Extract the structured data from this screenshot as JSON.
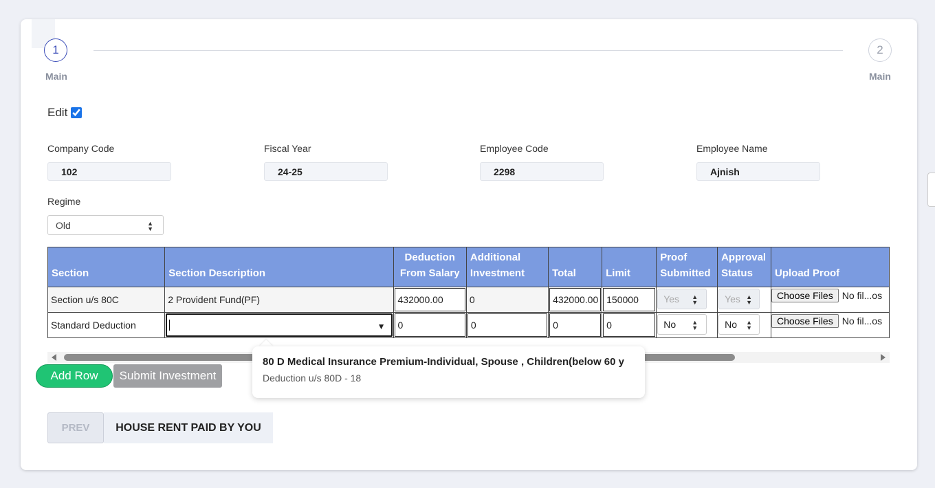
{
  "stepper": {
    "steps": [
      {
        "number": "1",
        "label": "Main"
      },
      {
        "number": "2",
        "label": "Main"
      }
    ]
  },
  "edit": {
    "label": "Edit",
    "checked": true
  },
  "fields": {
    "company_code": {
      "label": "Company Code",
      "value": "102"
    },
    "fiscal_year": {
      "label": "Fiscal Year",
      "value": "24-25"
    },
    "employee_code": {
      "label": "Employee Code",
      "value": "2298"
    },
    "employee_name": {
      "label": "Employee Name",
      "value": "Ajnish"
    }
  },
  "regime": {
    "label": "Regime",
    "value": "Old"
  },
  "table": {
    "headers": {
      "section": "Section",
      "section_description": "Section Description",
      "deduction_from_salary": "Deduction From Salary",
      "additional_investment": "Additional Investment",
      "total": "Total",
      "limit": "Limit",
      "proof_submitted": "Proof Submitted",
      "approval_status": "Approval Status",
      "upload_proof": "Upload Proof"
    },
    "rows": [
      {
        "section": "Section u/s 80C",
        "section_description": "2 Provident Fund(PF)",
        "deduction_from_salary": "432000.00",
        "additional_investment": "0",
        "total": "432000.00",
        "limit": "150000",
        "proof_submitted": "Yes",
        "approval_status": "Yes",
        "upload_button": "Choose Files",
        "upload_status": "No fil...os"
      },
      {
        "section": "Standard Deduction",
        "section_description": "",
        "deduction_from_salary": "0",
        "additional_investment": "0",
        "total": "0",
        "limit": "0",
        "proof_submitted": "No",
        "approval_status": "No",
        "upload_button": "Choose Files",
        "upload_status": "No fil...os"
      }
    ]
  },
  "dropdown_option": {
    "title": "80 D Medical Insurance Premium-Individual, Spouse , Children(below 60 y",
    "subtitle": "Deduction u/s 80D - 18"
  },
  "actions": {
    "add_row": "Add Row",
    "submit_investment": "Submit Investment"
  },
  "navigation": {
    "prev": "PREV",
    "next": "HOUSE RENT PAID BY YOU"
  }
}
